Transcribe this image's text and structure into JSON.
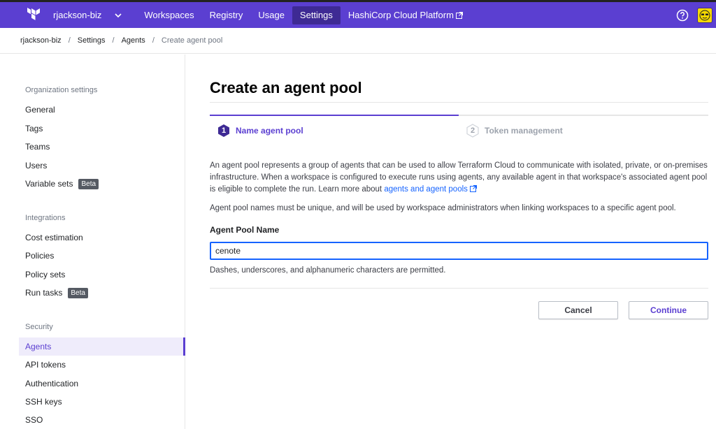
{
  "topnav": {
    "org": "rjackson-biz",
    "links": [
      {
        "label": "Workspaces"
      },
      {
        "label": "Registry"
      },
      {
        "label": "Usage"
      },
      {
        "label": "Settings"
      }
    ],
    "hcp_label": "HashiCorp Cloud Platform",
    "accent": "#5b3fd1"
  },
  "breadcrumb": [
    "rjackson-biz",
    "Settings",
    "Agents",
    "Create agent pool"
  ],
  "sidebar": {
    "groups": [
      {
        "title": "Organization settings",
        "items": [
          "General",
          "Tags",
          "Teams",
          "Users",
          "Variable sets"
        ]
      },
      {
        "title": "Integrations",
        "items": [
          "Cost estimation",
          "Policies",
          "Policy sets",
          "Run tasks"
        ]
      },
      {
        "title": "Security",
        "items": [
          "Agents",
          "API tokens",
          "Authentication",
          "SSH keys",
          "SSO"
        ]
      }
    ],
    "beta_label": "Beta",
    "active_item": "Agents"
  },
  "main": {
    "title": "Create an agent pool",
    "steps": [
      {
        "num": "1",
        "label": "Name agent pool",
        "state": "active"
      },
      {
        "num": "2",
        "label": "Token management",
        "state": "inactive"
      }
    ],
    "description": "An agent pool represents a group of agents that can be used to allow Terraform Cloud to communicate with isolated, private, or on-premises infrastructure. When a workspace is configured to execute runs using agents, any available agent in that workspace's associated agent pool is eligible to complete the run. Learn more about",
    "description_link": "agents and agent pools",
    "description2": "Agent pool names must be unique, and will be used by workspace administrators when linking workspaces to a specific agent pool.",
    "field_label": "Agent Pool Name",
    "field_value": "cenote",
    "field_help": "Dashes, underscores, and alphanumeric characters are permitted.",
    "cancel_label": "Cancel",
    "continue_label": "Continue"
  }
}
